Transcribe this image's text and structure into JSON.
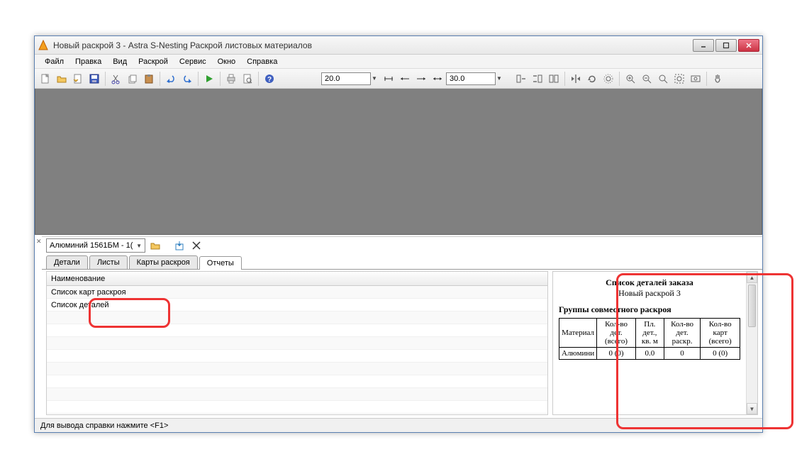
{
  "title": "Новый раскрой 3 - Astra S-Nesting Раскрой листовых материалов",
  "menus": [
    "Файл",
    "Правка",
    "Вид",
    "Раскрой",
    "Сервис",
    "Окно",
    "Справка"
  ],
  "toolbar": {
    "input1": "20.0",
    "input2": "30.0"
  },
  "combo_value": "Алюминий 1561БМ - 1(",
  "tabs": [
    "Детали",
    "Листы",
    "Карты раскроя",
    "Отчеты"
  ],
  "grid": {
    "header": "Наименование",
    "rows": [
      "Список карт раскроя",
      "Список деталей"
    ]
  },
  "preview": {
    "title": "Список деталей заказа",
    "subtitle": "Новый раскрой 3",
    "group_title": "Группы совместного раскроя",
    "headers": [
      "Материал",
      "Кол-во дет. (всего)",
      "Пл. дет., кв. м",
      "Кол-во дет. раскр.",
      "Кол-во карт (всего)"
    ],
    "row": [
      "Алюмини",
      "0 (0)",
      "0.0",
      "0",
      "0 (0)"
    ]
  },
  "status": "Для вывода справки нажмите <F1>"
}
